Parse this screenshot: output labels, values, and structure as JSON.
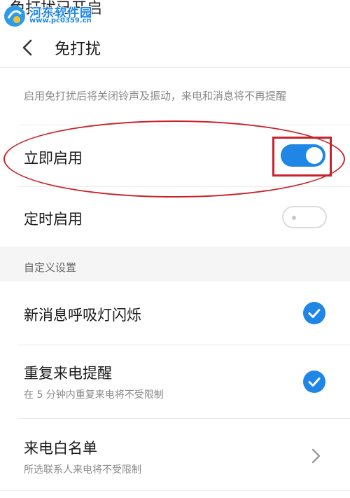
{
  "status_bar": {
    "text": "免打扰已开启"
  },
  "watermark": {
    "title": "河东软件园",
    "url": "www.pc0359.cn"
  },
  "header": {
    "back_icon": "back-arrow-icon",
    "title": "免打扰"
  },
  "description": "启用免打扰后将关闭铃声及振动，来电和消息将不再提醒",
  "rows": {
    "enable_now": {
      "label": "立即启用",
      "toggle_on": true
    },
    "scheduled": {
      "label": "定时启用",
      "toggle_on": false
    }
  },
  "section": {
    "title": "自定义设置"
  },
  "custom": {
    "breathing_light": {
      "label": "新消息呼吸灯闪烁",
      "checked": true
    },
    "repeat_call": {
      "label": "重复来电提醒",
      "sub": "在 5 分钟内重复来电将不受限制",
      "checked": true
    },
    "whitelist": {
      "label": "来电白名单",
      "sub": "所选联系人来电将不受限制",
      "icon": "chevron-right-icon"
    }
  },
  "colors": {
    "accent": "#1f86e5",
    "annotation": "#c8232c"
  }
}
